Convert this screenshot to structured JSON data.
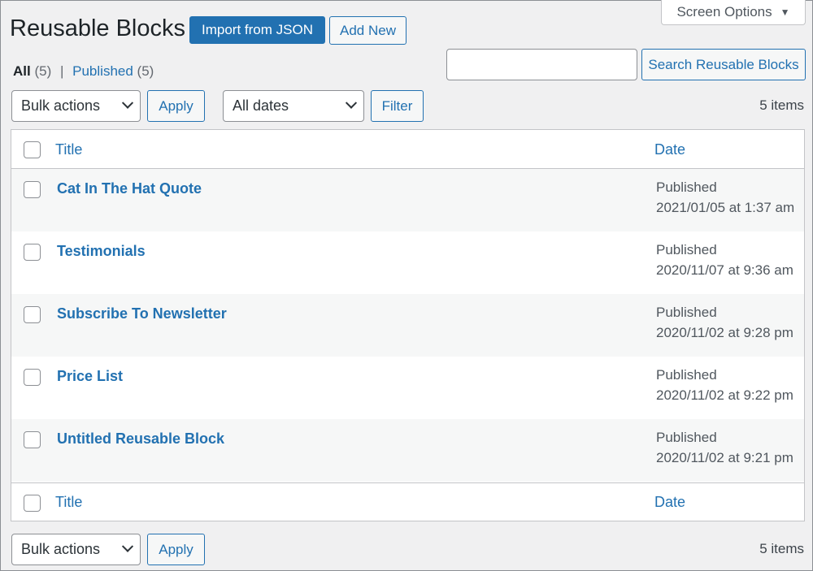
{
  "header": {
    "screen_options": "Screen Options",
    "title": "Reusable Blocks",
    "import_label": "Import from JSON",
    "add_new_label": "Add New"
  },
  "views": {
    "all_label": "All",
    "all_count": "(5)",
    "separator": "|",
    "published_label": "Published",
    "published_count": "(5)"
  },
  "search": {
    "value": "",
    "button_label": "Search Reusable Blocks"
  },
  "toolbar_top": {
    "bulk_selected": "Bulk actions",
    "apply_label": "Apply",
    "dates_selected": "All dates",
    "filter_label": "Filter",
    "items_count": "5 items"
  },
  "table": {
    "columns": {
      "title": "Title",
      "date": "Date"
    },
    "rows": [
      {
        "title": "Cat In The Hat Quote",
        "status": "Published",
        "date": "2021/01/05 at 1:37 am"
      },
      {
        "title": "Testimonials",
        "status": "Published",
        "date": "2020/11/07 at 9:36 am"
      },
      {
        "title": "Subscribe To Newsletter",
        "status": "Published",
        "date": "2020/11/02 at 9:28 pm"
      },
      {
        "title": "Price List",
        "status": "Published",
        "date": "2020/11/02 at 9:22 pm"
      },
      {
        "title": "Untitled Reusable Block",
        "status": "Published",
        "date": "2020/11/02 at 9:21 pm"
      }
    ]
  },
  "toolbar_bottom": {
    "bulk_selected": "Bulk actions",
    "apply_label": "Apply",
    "items_count": "5 items"
  },
  "colors": {
    "accent": "#2271b1",
    "background": "#f0f0f1",
    "text": "#1d2327"
  }
}
